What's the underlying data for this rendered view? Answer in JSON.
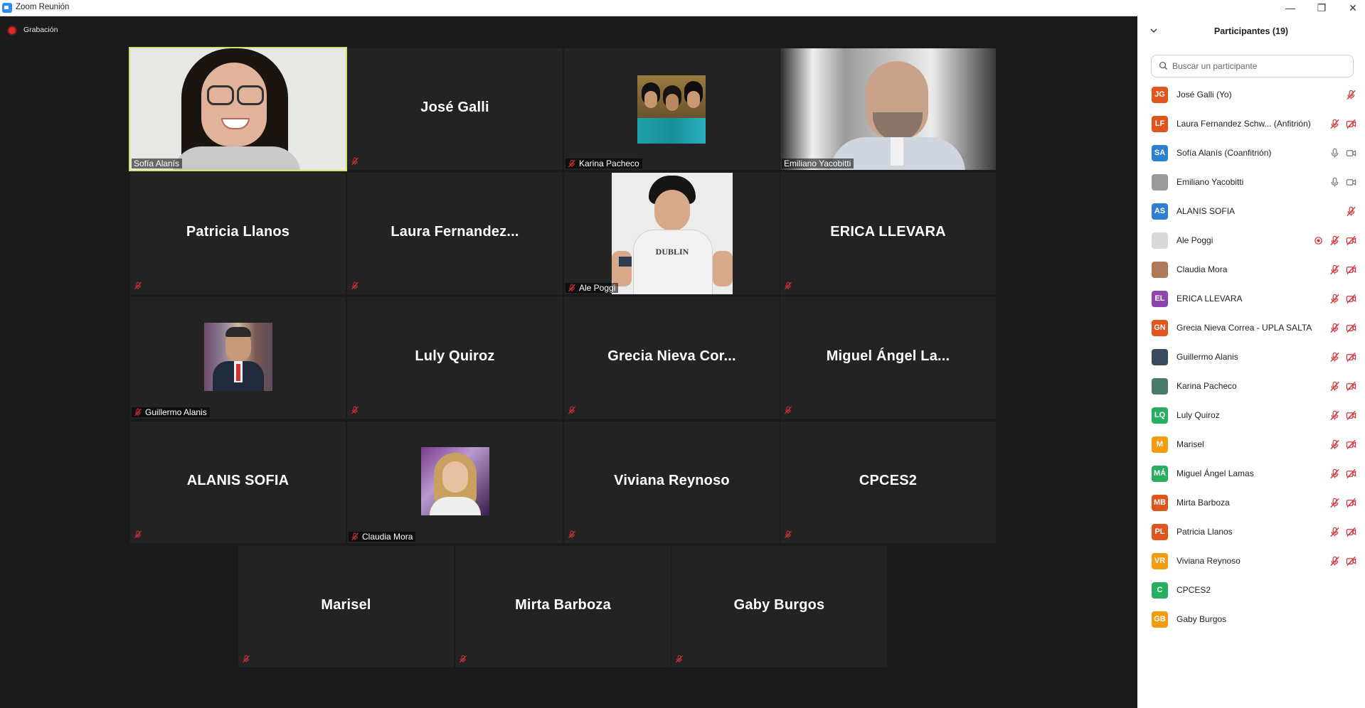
{
  "window": {
    "title": "Zoom Reunión"
  },
  "recording": {
    "label": "Grabación"
  },
  "tiles": [
    {
      "name": "Sofía Alanís",
      "kind": "video-woman"
    },
    {
      "name": "José Galli",
      "kind": "text"
    },
    {
      "name": "Karina Pacheco",
      "kind": "photo-friends"
    },
    {
      "name": "Emiliano Yacobitti",
      "kind": "video-man"
    },
    {
      "name": "Patricia Llanos",
      "kind": "text"
    },
    {
      "name": "Laura  Fernandez...",
      "kind": "text"
    },
    {
      "name": "Ale Poggi",
      "kind": "photo-shirt",
      "shirt_text": "DUBLIN"
    },
    {
      "name": "ERICA LLEVARA",
      "kind": "text"
    },
    {
      "name": "Guillermo Alanis",
      "kind": "photo-suit"
    },
    {
      "name": "Luly Quiroz",
      "kind": "text"
    },
    {
      "name": "Grecia  Nieva Cor...",
      "kind": "text"
    },
    {
      "name": "Miguel  Ángel  La...",
      "kind": "text"
    },
    {
      "name": "ALANIS SOFIA",
      "kind": "text"
    },
    {
      "name": "Claudia Mora",
      "kind": "photo-woman"
    },
    {
      "name": "Viviana Reynoso",
      "kind": "text"
    },
    {
      "name": "CPCES2",
      "kind": "text"
    },
    {
      "name": "Marisel",
      "kind": "text"
    },
    {
      "name": "Mirta Barboza",
      "kind": "text"
    },
    {
      "name": "Gaby Burgos",
      "kind": "text"
    }
  ],
  "panel": {
    "title": "Participantes (19)",
    "search_placeholder": "Buscar un participante",
    "participants": [
      {
        "initials": "JG",
        "color": "#e0551c",
        "name": "José Galli (Yo)",
        "mic": "muted",
        "video": "none"
      },
      {
        "initials": "LF",
        "color": "#e0551c",
        "name": "Laura Fernandez Schw...  (Anfitrión)",
        "mic": "muted",
        "video": "off"
      },
      {
        "initials": "SA",
        "color": "#2f7fd1",
        "name": "Sofía Alanís (Coanfitrión)",
        "mic": "on",
        "video": "on"
      },
      {
        "initials": "",
        "color": "#9a9a9a",
        "name": "Emiliano Yacobitti",
        "mic": "on",
        "video": "on"
      },
      {
        "initials": "AS",
        "color": "#2f7fd1",
        "name": "ALANIS SOFIA",
        "mic": "muted",
        "video": "none"
      },
      {
        "initials": "",
        "color": "#d9d9d9",
        "name": "Ale Poggi",
        "mic": "muted",
        "video": "off",
        "recording": true
      },
      {
        "initials": "",
        "color": "#b07a5a",
        "name": "Claudia Mora",
        "mic": "muted",
        "video": "off"
      },
      {
        "initials": "EL",
        "color": "#8e44ad",
        "name": "ERICA LLEVARA",
        "mic": "muted",
        "video": "off"
      },
      {
        "initials": "GN",
        "color": "#e0551c",
        "name": "Grecia Nieva Correa - UPLA SALTA",
        "mic": "muted",
        "video": "off"
      },
      {
        "initials": "",
        "color": "#3b4a5e",
        "name": "Guillermo Alanis",
        "mic": "muted",
        "video": "off"
      },
      {
        "initials": "",
        "color": "#4a7a6a",
        "name": "Karina Pacheco",
        "mic": "muted",
        "video": "off"
      },
      {
        "initials": "LQ",
        "color": "#27ae60",
        "name": "Luly Quiroz",
        "mic": "muted",
        "video": "off"
      },
      {
        "initials": "M",
        "color": "#f39c12",
        "name": "Marisel",
        "mic": "muted",
        "video": "off"
      },
      {
        "initials": "MÁ",
        "color": "#27ae60",
        "name": "Miguel Ángel Lamas",
        "mic": "muted",
        "video": "off"
      },
      {
        "initials": "MB",
        "color": "#e0551c",
        "name": "Mirta Barboza",
        "mic": "muted",
        "video": "off"
      },
      {
        "initials": "PL",
        "color": "#e0551c",
        "name": "Patricia Llanos",
        "mic": "muted",
        "video": "off"
      },
      {
        "initials": "VR",
        "color": "#f39c12",
        "name": "Viviana Reynoso",
        "mic": "muted",
        "video": "off"
      },
      {
        "initials": "C",
        "color": "#27ae60",
        "name": "CPCES2",
        "mic": "none",
        "video": "none"
      },
      {
        "initials": "GB",
        "color": "#f39c12",
        "name": "Gaby Burgos",
        "mic": "none",
        "video": "none"
      }
    ]
  }
}
